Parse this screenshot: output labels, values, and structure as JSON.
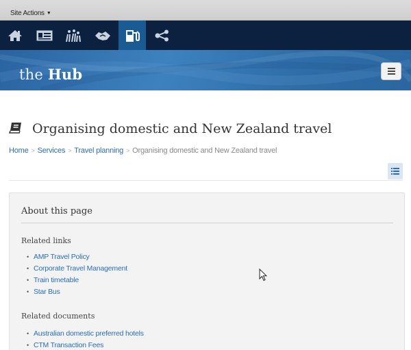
{
  "site_actions": {
    "label": "Site Actions"
  },
  "nav": {
    "items": [
      {
        "name": "home",
        "icon": "home-icon",
        "active": false
      },
      {
        "name": "profile",
        "icon": "id-card-icon",
        "active": false
      },
      {
        "name": "people",
        "icon": "people-icon",
        "active": false
      },
      {
        "name": "hands",
        "icon": "handshake-icon",
        "active": false
      },
      {
        "name": "fuel",
        "icon": "fuel-pump-icon",
        "active": true
      },
      {
        "name": "share",
        "icon": "share-icon",
        "active": false
      }
    ]
  },
  "banner": {
    "logo_prefix": "the",
    "logo_strong": "Hub"
  },
  "page": {
    "title": "Organising domestic and New Zealand travel",
    "title_icon": "book-icon"
  },
  "breadcrumb": {
    "items": [
      "Home",
      "Services",
      "Travel planning"
    ],
    "current": "Organising domestic and New Zealand travel"
  },
  "about": {
    "title": "About this page",
    "related_links_heading": "Related links",
    "related_links": [
      "AMP Travel Policy",
      "Corporate Travel Management",
      "Train timetable",
      "Star Bus"
    ],
    "related_documents_heading": "Related documents",
    "related_documents": [
      "Australian domestic preferred hotels",
      "CTM Transaction Fees"
    ]
  },
  "colors": {
    "nav_bg": "#0c2140",
    "nav_active": "#1b5b94",
    "link": "#2a6db5",
    "banner": "#3d82bf"
  }
}
